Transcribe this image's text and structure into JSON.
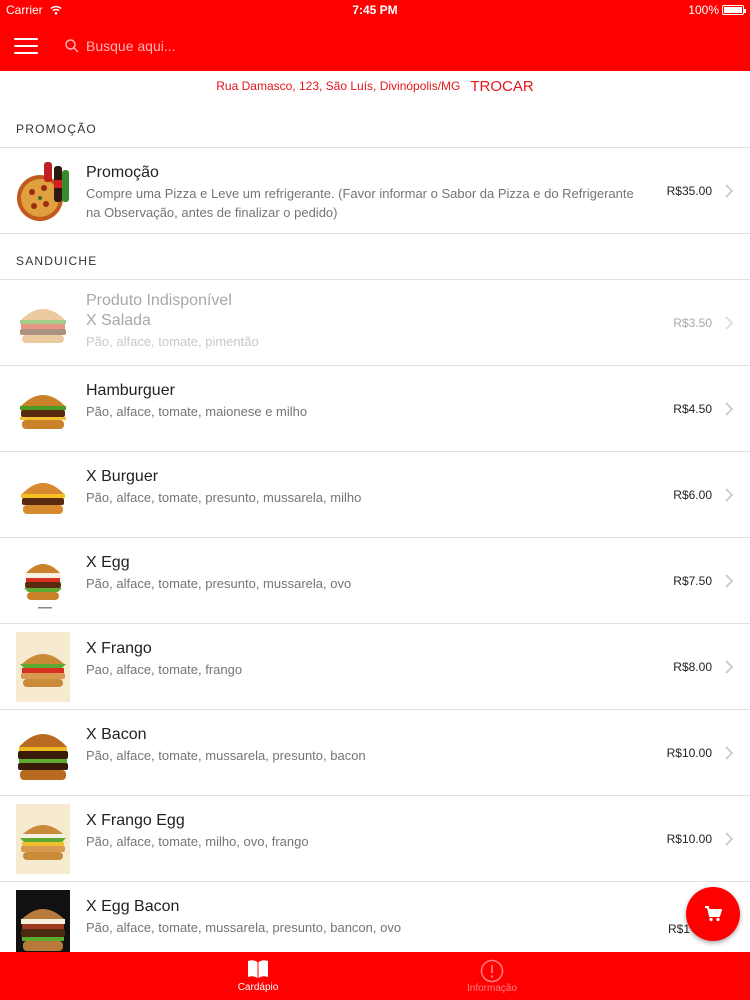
{
  "status_bar": {
    "carrier": "Carrier",
    "time": "7:45 PM",
    "battery": "100%"
  },
  "header": {
    "search_placeholder": "Busque aqui...",
    "icons": {
      "menu": "hamburger-menu-icon",
      "search": "search-icon"
    }
  },
  "address": {
    "text": "Rua Damasco, 123, São Luís, Divinópolis/MG",
    "change_label": "TROCAR"
  },
  "colors": {
    "brand": "#ff0000",
    "accent_text": "#e4161b",
    "inactive_tab": "#ff8080"
  },
  "sections": [
    {
      "title": "PROMOÇÃO",
      "items": [
        {
          "title": "Promoção",
          "desc": "Compre uma Pizza e Leve um refrigerante. (Favor informar o Sabor da Pizza e do Refrigerante na Observação, antes de finalizar o pedido)",
          "price": "R$35.00",
          "image": "pizza-and-soda"
        }
      ]
    },
    {
      "title": "SANDUICHE",
      "items": [
        {
          "unavailable_label": "Produto Indisponível",
          "title": "X Salada",
          "desc": "Pão, alface, tomate, pimentão",
          "price": "R$3.50",
          "image": "burger-salad"
        },
        {
          "title": "Hamburguer",
          "desc": "Pão, alface, tomate, maionese e milho",
          "price": "R$4.50",
          "image": "burger-classic"
        },
        {
          "title": "X Burguer",
          "desc": "Pão, alface, tomate, presunto, mussarela, milho",
          "price": "R$6.00",
          "image": "burger-cheese"
        },
        {
          "title": "X Egg",
          "desc": "Pão, alface, tomate, presunto, mussarela, ovo",
          "price": "R$7.50",
          "image": "burger-egg"
        },
        {
          "title": "X Frango",
          "desc": "Pao, alface, tomate, frango",
          "price": "R$8.00",
          "image": "burger-chicken"
        },
        {
          "title": "X Bacon",
          "desc": "Pão, alface, tomate, mussarela, presunto, bacon",
          "price": "R$10.00",
          "image": "burger-bacon"
        },
        {
          "title": "X Frango Egg",
          "desc": "Pão, alface, tomate, milho, ovo, frango",
          "price": "R$10.00",
          "image": "burger-chicken-egg"
        },
        {
          "title": "X Egg Bacon",
          "desc": "Pão, alface, tomate, mussarela, presunto, bancon, ovo",
          "price": "R$1",
          "image": "burger-egg-bacon"
        }
      ]
    }
  ],
  "fab": {
    "icon": "shopping-cart-icon"
  },
  "tabs": [
    {
      "label": "Cardápio",
      "icon": "book-icon",
      "active": true
    },
    {
      "label": "Informação",
      "icon": "info-icon",
      "active": false
    }
  ]
}
